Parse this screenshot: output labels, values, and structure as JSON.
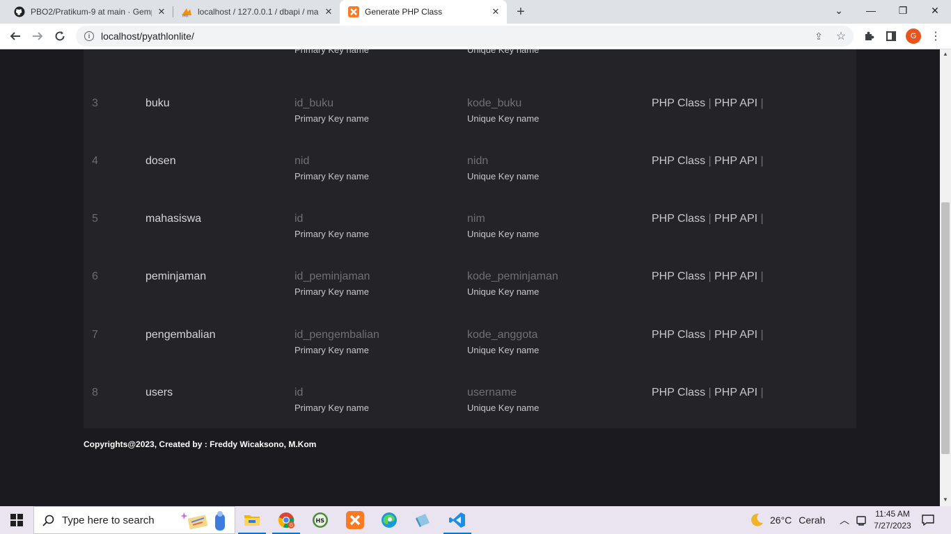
{
  "browser": {
    "tabs": [
      {
        "title": "PBO2/Pratikum-9 at main · Gemp",
        "icon": "github-icon"
      },
      {
        "title": "localhost / 127.0.0.1 / dbapi / ma",
        "icon": "phpmyadmin-icon"
      },
      {
        "title": "Generate PHP Class",
        "icon": "xampp-icon"
      }
    ],
    "url": "localhost/pyathlonlite/",
    "profile_initial": "G"
  },
  "table": {
    "pk_caption": "Primary Key name",
    "uk_caption": "Unique Key name",
    "action_class": "PHP Class",
    "action_api": "PHP API",
    "separator": "|",
    "rows": [
      {
        "no": "",
        "name": "",
        "pk": "",
        "uk": ""
      },
      {
        "no": "3",
        "name": "buku",
        "pk": "id_buku",
        "uk": "kode_buku"
      },
      {
        "no": "4",
        "name": "dosen",
        "pk": "nid",
        "uk": "nidn"
      },
      {
        "no": "5",
        "name": "mahasiswa",
        "pk": "id",
        "uk": "nim"
      },
      {
        "no": "6",
        "name": "peminjaman",
        "pk": "id_peminjaman",
        "uk": "kode_peminjaman"
      },
      {
        "no": "7",
        "name": "pengembalian",
        "pk": "id_pengembalian",
        "uk": "kode_anggota"
      },
      {
        "no": "8",
        "name": "users",
        "pk": "id",
        "uk": "username"
      }
    ]
  },
  "footer": "Copyrights@2023, Created by : Freddy Wicaksono, M.Kom",
  "taskbar": {
    "search_placeholder": "Type here to search",
    "weather_temp": "26°C",
    "weather_text": "Cerah",
    "time": "11:45 AM",
    "date": "7/27/2023"
  },
  "colors": {
    "page_bg": "#1b1b1f",
    "panel_bg": "#242428",
    "accent": "#0078d4"
  }
}
